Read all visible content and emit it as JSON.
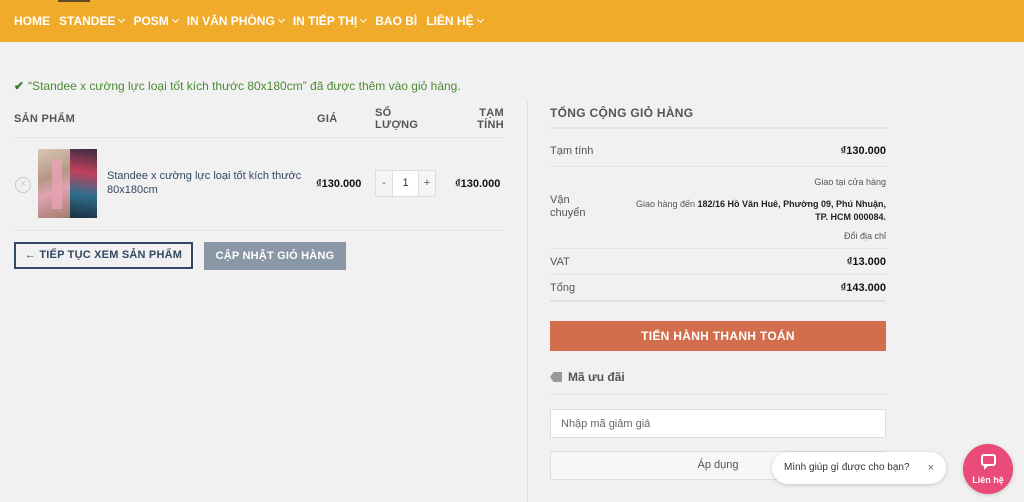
{
  "nav": {
    "items": [
      {
        "label": "HOME",
        "has_dropdown": false
      },
      {
        "label": "STANDEE",
        "has_dropdown": true
      },
      {
        "label": "POSM",
        "has_dropdown": true
      },
      {
        "label": "IN VĂN PHÒNG",
        "has_dropdown": true
      },
      {
        "label": "IN TIẾP THỊ",
        "has_dropdown": true
      },
      {
        "label": "BAO BÌ",
        "has_dropdown": false
      },
      {
        "label": "LIÊN HỆ",
        "has_dropdown": true
      }
    ]
  },
  "notice": {
    "icon": "check-icon",
    "text": "“Standee x cường lực loại tốt kích thước 80x180cm” đã được thêm vào giỏ hàng."
  },
  "cart": {
    "headers": {
      "product": "SẢN PHẨM",
      "price": "GIÁ",
      "quantity_line1": "SỐ",
      "quantity_line2": "LƯỢNG",
      "subtotal_line1": "TẠM",
      "subtotal_line2": "TÍNH"
    },
    "items": [
      {
        "name": "Standee x cường lực loại tốt kích thước 80x180cm",
        "price": "₫130.000",
        "quantity": "1",
        "subtotal": "₫130.000"
      }
    ],
    "qty_minus": "-",
    "qty_plus": "+",
    "remove_symbol": "×",
    "continue_label": "← TIẾP TỤC XEM SẢN PHẨM",
    "update_label": "CẬP NHẬT GIỎ HÀNG"
  },
  "totals": {
    "title": "TỔNG CỘNG GIỎ HÀNG",
    "subtotal_label": "Tạm tính",
    "subtotal_value": "₫130.000",
    "shipping_label_line1": "Vận",
    "shipping_label_line2": "chuyển",
    "shipping_option": "Giao tại cửa hàng",
    "shipping_to_prefix": "Giao hàng đến ",
    "shipping_address_line1": "182/16 Hồ Văn Huê, Phường 09, Phú Nhuận,",
    "shipping_address_line2": "TP. HCM 000084.",
    "change_address": "Đổi địa chỉ",
    "vat_label": "VAT",
    "vat_value": "₫13.000",
    "total_label": "Tổng",
    "total_value": "₫143.000",
    "checkout_label": "TIẾN HÀNH THANH TOÁN"
  },
  "coupon": {
    "icon": "tag-icon",
    "heading": "Mã ưu đãi",
    "placeholder": "Nhập mã giảm giá",
    "apply_label": "Áp dụng"
  },
  "chat": {
    "bubble_text": "Mình giúp gì được cho bạn?",
    "close_symbol": "×",
    "button_label": "Liên hệ",
    "icon": "chat-icon",
    "accent": "#e94a77"
  },
  "colors": {
    "nav_bg": "#f0ab2b",
    "checkout": "#d26e4b",
    "link": "#334862"
  }
}
